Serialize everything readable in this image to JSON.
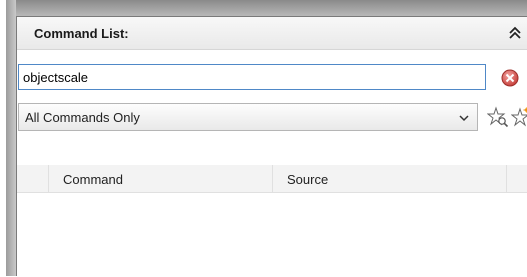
{
  "panel": {
    "title": "Command List:",
    "collapse_icon": "double-chevron-up-icon"
  },
  "search": {
    "value": "objectscale",
    "placeholder": "",
    "clear_icon": "clear-circle-icon"
  },
  "filter": {
    "selected": "All Commands Only",
    "find_icon": "star-search-icon",
    "new_icon": "star-new-icon"
  },
  "table": {
    "columns": [
      "Command",
      "Source"
    ],
    "rows": []
  },
  "colors": {
    "accent_border": "#4f88c7",
    "clear_red": "#d9534f"
  }
}
